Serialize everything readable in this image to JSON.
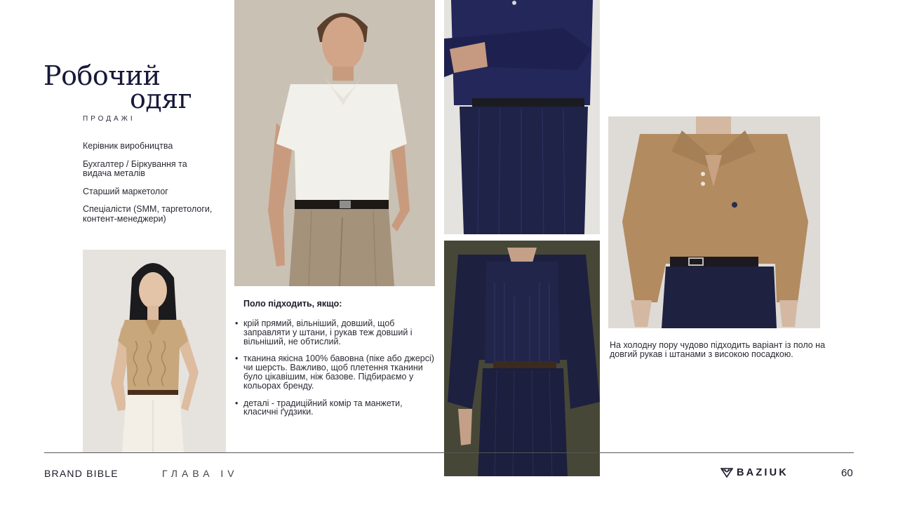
{
  "title": {
    "line1": "Робочий",
    "line2": "одяг",
    "subtitle": "ПРОДАЖІ"
  },
  "roles": [
    "Керівник виробництва",
    "Бухгалтер / Біркування та видача металів",
    "Старший маркетолог",
    "Спеціалісти (SMM, таргетологи, контент-менеджери)"
  ],
  "polo": {
    "heading": "Поло підходить, якщо:",
    "bullet_symbol": "•",
    "items": [
      "крій прямий, вільніший, довший, щоб заправляти у штани, і рукав теж довший і вільніший, не обтислий.",
      "тканина якісна 100% бавовна (піке або джерсі) чи шерсть. Важливо, щоб плетення тканини було цікавішим, ніж базове. Підбираємо у кольорах бренду.",
      "деталі - традиційний комір та манжети, класичні ґудзики."
    ]
  },
  "caption": "На холодну пору чудово підходить варіант із поло на довгий рукав і штанами з високою посадкою.",
  "footer": {
    "brand_bible": "BRAND BIBLE",
    "chapter": "ГЛАВА IV",
    "logo_text": "BAZIUK",
    "page_number": "60"
  },
  "photos": {
    "woman_cable_knit_polo": {
      "icon": "photo-woman-beige-cable-knit-polo"
    },
    "man_white_polo": {
      "icon": "photo-man-white-polo"
    },
    "navy_longsleeve_polo": {
      "icon": "photo-navy-longsleeve-polo"
    },
    "navy_knit_set": {
      "icon": "photo-navy-knit-set"
    },
    "camel_polo_sweater": {
      "icon": "photo-camel-polo-sweater"
    }
  },
  "colors": {
    "navy": "#17193a",
    "camel": "#b08a5e",
    "beige": "#cdb08a",
    "text": "#1c1c2b"
  }
}
